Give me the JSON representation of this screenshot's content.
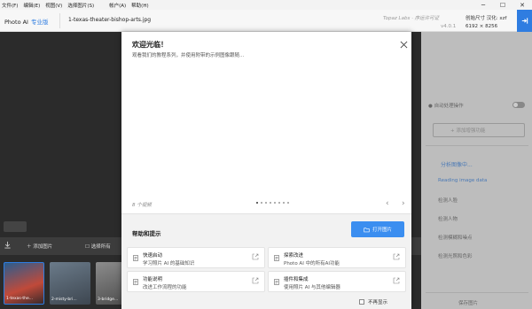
{
  "menu": [
    "文件(F)",
    "编辑(E)",
    "视图(V)",
    "选择图片(S)",
    "帐户(A)",
    "帮助(H)"
  ],
  "header": {
    "app_name": "Photo AI",
    "edition": "专业版",
    "filename": "1-texas-theater-bishop-arts.jpg",
    "company": "Topaz Labs · 序运许可证",
    "version": "v4.0.1",
    "original_size_label": "创始尺寸 汉化: xzf",
    "dimensions": "6192 × 8256"
  },
  "workspace": {
    "add_image": "添加图片",
    "select_all": "选择所有",
    "thumbnails": [
      "1-texas-the...",
      "2-misty-bri...",
      "3-bridge...",
      ""
    ]
  },
  "right_panel": {
    "auto_label": "自动处理操作",
    "add_button": "+ 添加增强功能",
    "analyzing": "分析图像中...",
    "reading": "Reading image data",
    "items": [
      "检测人脸",
      "检测人物",
      "检测模糊和噪点",
      "检测光照和色彩"
    ],
    "bottom": "保存图片"
  },
  "modal": {
    "title": "欢迎光临！",
    "subtitle": "观看我们的教程系列，并使用附带的示例图像跟随...",
    "video_count": "8 个视频",
    "prev": "‹",
    "next": "›",
    "help_title": "帮助和提示",
    "open_button": "打开图片",
    "cards": [
      {
        "title": "快速启动",
        "subtitle": "学习照片 AI 的基础知识"
      },
      {
        "title": "探索改进",
        "subtitle": "Photo AI 中的所有AI功能"
      },
      {
        "title": "功能说明",
        "subtitle": "改进工作流程的功能"
      },
      {
        "title": "插件和集成",
        "subtitle": "使用照片 AI 与其他编辑器"
      }
    ],
    "dont_show": "不再显示"
  },
  "colors": {
    "accent": "#3b8ef0",
    "export": "#2f7de1"
  }
}
